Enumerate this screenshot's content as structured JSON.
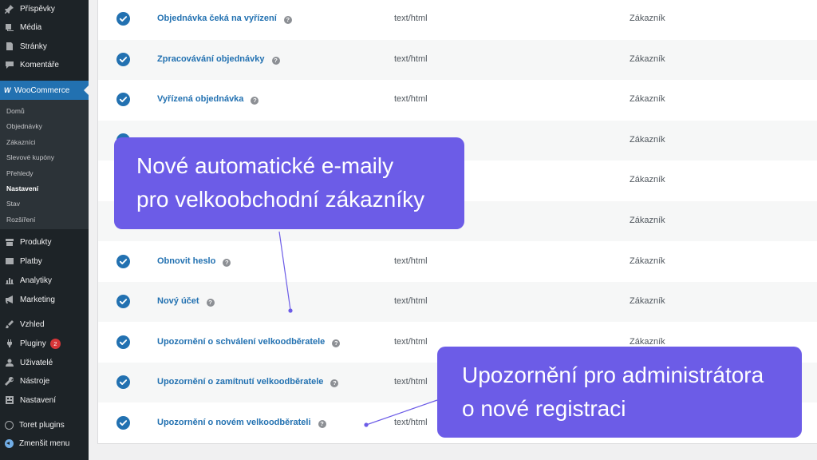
{
  "sidebar": {
    "top_items": [
      {
        "label": "Příspěvky",
        "icon": "pin-icon"
      },
      {
        "label": "Média",
        "icon": "media-icon"
      },
      {
        "label": "Stránky",
        "icon": "pages-icon"
      },
      {
        "label": "Komentáře",
        "icon": "comment-icon"
      }
    ],
    "woocommerce": {
      "logo": "W",
      "label": "WooCommerce"
    },
    "submenu": [
      "Domů",
      "Objednávky",
      "Zákazníci",
      "Slevové kupóny",
      "Přehledy",
      "Nastavení",
      "Stav",
      "Rozšíření"
    ],
    "submenu_current": "Nastavení",
    "lower_items": [
      {
        "label": "Produkty",
        "icon": "archive-icon"
      },
      {
        "label": "Platby",
        "icon": "money-icon"
      },
      {
        "label": "Analytiky",
        "icon": "chart-icon"
      },
      {
        "label": "Marketing",
        "icon": "megaphone-icon"
      },
      {
        "label": "Vzhled",
        "icon": "brush-icon"
      },
      {
        "label": "Pluginy",
        "icon": "plugin-icon",
        "badge": "2"
      },
      {
        "label": "Uživatelé",
        "icon": "user-icon"
      },
      {
        "label": "Nástroje",
        "icon": "wrench-icon"
      },
      {
        "label": "Nastavení",
        "icon": "settings-icon"
      },
      {
        "label": "Toret plugins",
        "icon": "circle-icon"
      },
      {
        "label": "Zmenšit menu",
        "icon": "collapse-icon"
      }
    ]
  },
  "email_table": {
    "rows": [
      {
        "title": "Objednávka čeká na vyřízení",
        "content_type": "text/html",
        "recipient": "Zákazník",
        "title_visible": true,
        "type_visible": true,
        "recipient_visible": true
      },
      {
        "title": "Zpracovávání objednávky",
        "content_type": "text/html",
        "recipient": "Zákazník",
        "title_visible": true,
        "type_visible": true,
        "recipient_visible": true
      },
      {
        "title": "Vyřízená objednávka",
        "content_type": "text/html",
        "recipient": "Zákazník",
        "title_visible": true,
        "type_visible": true,
        "recipient_visible": true
      },
      {
        "title": "",
        "content_type": "",
        "recipient": "Zákazník",
        "title_visible": false,
        "type_visible": false,
        "recipient_visible": true
      },
      {
        "title": "",
        "content_type": "",
        "recipient": "Zákazník",
        "title_visible": false,
        "type_visible": false,
        "recipient_visible": true
      },
      {
        "title": "",
        "content_type": "",
        "recipient": "Zákazník",
        "title_visible": false,
        "type_visible": false,
        "recipient_visible": true
      },
      {
        "title": "Obnovit heslo",
        "content_type": "text/html",
        "recipient": "Zákazník",
        "title_visible": true,
        "type_visible": true,
        "recipient_visible": true
      },
      {
        "title": "Nový účet",
        "content_type": "text/html",
        "recipient": "Zákazník",
        "title_visible": true,
        "type_visible": true,
        "recipient_visible": true
      },
      {
        "title": "Upozornění o schválení velkoodběratele",
        "content_type": "text/html",
        "recipient": "Zákazník",
        "title_visible": true,
        "type_visible": true,
        "recipient_visible": true
      },
      {
        "title": "Upozornění o zamítnutí velkoodběratele",
        "content_type": "text/html",
        "recipient": "",
        "title_visible": true,
        "type_visible": true,
        "recipient_visible": false
      },
      {
        "title": "Upozornění o novém velkoodběrateli",
        "content_type": "text/html",
        "recipient": "",
        "title_visible": true,
        "type_visible": true,
        "recipient_visible": false
      }
    ],
    "help_glyph": "?"
  },
  "callouts": [
    {
      "lines": [
        "Nové automatické e-maily",
        "pro velkoobchodní zákazníky"
      ]
    },
    {
      "lines": [
        "Upozornění pro administrátora",
        "o nové registraci"
      ]
    }
  ],
  "colors": {
    "sidebar_bg": "#1d2327",
    "accent": "#2271b1",
    "callout": "#6c5ce7",
    "badge": "#d63638"
  }
}
